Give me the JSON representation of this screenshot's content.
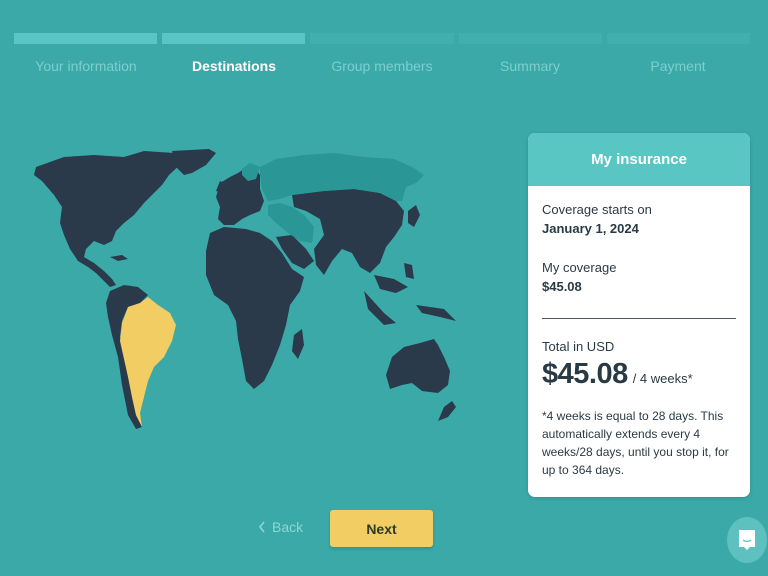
{
  "colors": {
    "background": "#3aa9a8",
    "progress_done": "#5ac6c4",
    "progress_todo": "#40afae",
    "land": "#2a3a4a",
    "excluded_region": "#2a9696",
    "selected_destination": "#f2cd63",
    "accent_button": "#f2cd63"
  },
  "progress": {
    "completed_steps": 2,
    "total_steps": 5
  },
  "steps": [
    {
      "label": "Your information",
      "state": "done"
    },
    {
      "label": "Destinations",
      "state": "active"
    },
    {
      "label": "Group members",
      "state": "todo"
    },
    {
      "label": "Summary",
      "state": "todo"
    },
    {
      "label": "Payment",
      "state": "todo"
    }
  ],
  "map": {
    "selected_regions": [
      "South America"
    ],
    "excluded_regions": [
      "Russia",
      "Iran",
      "Caucasus",
      "Scandinavia (partial)"
    ]
  },
  "card": {
    "title": "My insurance",
    "coverage_start_label": "Coverage starts on",
    "coverage_start_value": "January 1, 2024",
    "coverage_label": "My coverage",
    "coverage_value": "$45.08",
    "total_label": "Total in USD",
    "total_amount": "$45.08",
    "total_period": "/ 4 weeks*",
    "footnote": "*4 weeks is equal to 28 days. This automatically extends every 4 weeks/28 days, until you stop it, for up to 364 days."
  },
  "nav": {
    "back_label": "Back",
    "back_icon": "chevron-left",
    "next_label": "Next"
  },
  "chat": {
    "icon": "chat-bubble-smile"
  }
}
